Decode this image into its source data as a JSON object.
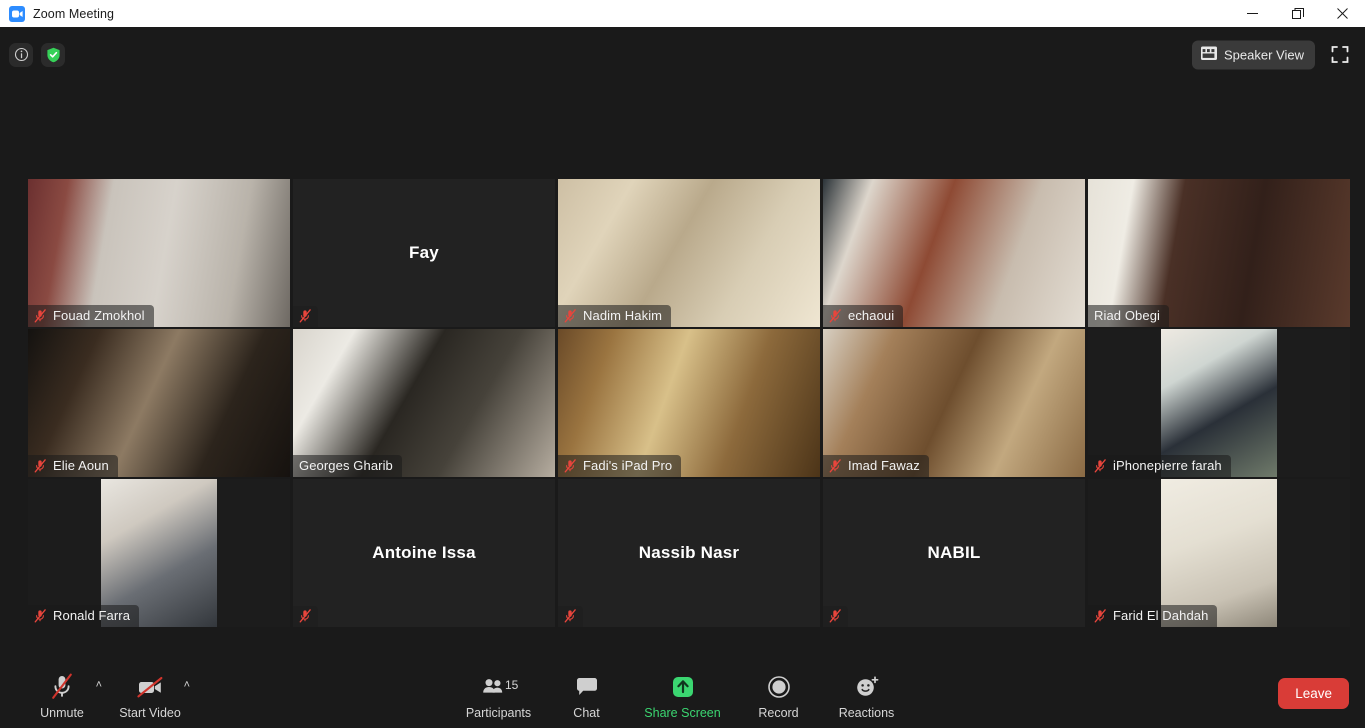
{
  "window": {
    "title": "Zoom Meeting",
    "app_icon": "zoom-camera-icon",
    "minimize_label": "—",
    "maximize_label": "❐",
    "close_label": "✕"
  },
  "topbar": {
    "info_icon": "info-icon",
    "shield_icon": "encryption-shield-icon",
    "view_button": {
      "label": "Speaker View",
      "icon": "grid-view-icon"
    },
    "fullscreen_icon": "fullscreen-icon"
  },
  "grid": {
    "tiles": [
      {
        "name": "Fouad Zmokhol",
        "video": true,
        "muted": true,
        "speaking": false,
        "layout": "full",
        "style": "fouad"
      },
      {
        "name": "Fay",
        "video": false,
        "muted": true,
        "speaking": false,
        "layout": "none",
        "style": ""
      },
      {
        "name": "Nadim Hakim",
        "video": true,
        "muted": true,
        "speaking": false,
        "layout": "full",
        "style": "nadim"
      },
      {
        "name": "echaoui",
        "video": true,
        "muted": true,
        "speaking": false,
        "layout": "full",
        "style": "echaoui"
      },
      {
        "name": "Riad Obegi",
        "video": true,
        "muted": false,
        "speaking": false,
        "layout": "full",
        "style": "riad"
      },
      {
        "name": "Elie Aoun",
        "video": true,
        "muted": true,
        "speaking": false,
        "layout": "full",
        "style": "elie"
      },
      {
        "name": "Georges Gharib",
        "video": true,
        "muted": false,
        "speaking": true,
        "layout": "full",
        "style": "georges"
      },
      {
        "name": "Fadi's iPad Pro",
        "video": true,
        "muted": true,
        "speaking": false,
        "layout": "full",
        "style": "fadi"
      },
      {
        "name": "Imad Fawaz",
        "video": true,
        "muted": true,
        "speaking": false,
        "layout": "full",
        "style": "imad"
      },
      {
        "name": "iPhonepierre farah",
        "video": true,
        "muted": true,
        "speaking": false,
        "layout": "pillar",
        "style": "pierre"
      },
      {
        "name": "Ronald Farra",
        "video": true,
        "muted": true,
        "speaking": false,
        "layout": "pillar",
        "style": "ronald"
      },
      {
        "name": "Antoine Issa",
        "video": false,
        "muted": true,
        "speaking": false,
        "layout": "none",
        "style": ""
      },
      {
        "name": "Nassib Nasr",
        "video": false,
        "muted": true,
        "speaking": false,
        "layout": "none",
        "style": ""
      },
      {
        "name": "NABIL",
        "video": false,
        "muted": true,
        "speaking": false,
        "layout": "none",
        "style": ""
      },
      {
        "name": "Farid El Dahdah",
        "video": true,
        "muted": true,
        "speaking": false,
        "layout": "pillar",
        "style": "farid"
      }
    ],
    "active_speaker_color": "#c3e356",
    "mute_icon": "muted-microphone-icon"
  },
  "toolbar": {
    "audio": {
      "label": "Unmute",
      "icon": "microphone-muted-icon",
      "caret": "˄"
    },
    "video": {
      "label": "Start Video",
      "icon": "camera-off-icon",
      "caret": "˄"
    },
    "participants": {
      "label": "Participants",
      "icon": "participants-icon",
      "count": "15"
    },
    "chat": {
      "label": "Chat",
      "icon": "chat-bubble-icon"
    },
    "share": {
      "label": "Share Screen",
      "icon": "share-screen-icon",
      "color": "#3bd671"
    },
    "record": {
      "label": "Record",
      "icon": "record-icon"
    },
    "reactions": {
      "label": "Reactions",
      "icon": "reactions-smiley-icon"
    },
    "leave": {
      "label": "Leave",
      "color": "#d93c37"
    }
  }
}
